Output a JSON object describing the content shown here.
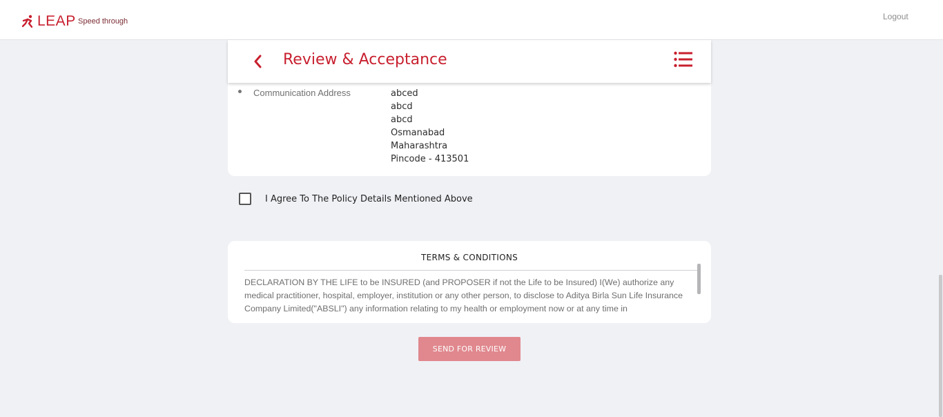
{
  "brand": {
    "name": "LEAP",
    "tagline": "Speed through",
    "accent_color": "#c8202f"
  },
  "topbar": {
    "logout_label": "Logout"
  },
  "header": {
    "title": "Review & Acceptance",
    "back_icon": "chevron-left-icon",
    "menu_icon": "list-menu-icon"
  },
  "details": {
    "communication_address": {
      "label": "Communication Address",
      "lines": [
        "abced",
        "abcd",
        "abcd",
        "Osmanabad",
        "Maharashtra",
        "Pincode - 413501"
      ]
    }
  },
  "agreement": {
    "label": "I Agree To The Policy Details Mentioned Above",
    "checked": false
  },
  "terms": {
    "title": "TERMS & CONDITIONS",
    "body": "DECLARATION BY THE LIFE to be INSURED (and PROPOSER if not the Life to be Insured) I(We) authorize any medical practitioner, hospital, employer, institution or any other person, to disclose to Aditya Birla Sun Life Insurance Company Limited(\"ABSLI\") any information relating to my health or employment now or at any time in"
  },
  "actions": {
    "send_label": "SEND FOR REVIEW",
    "send_color": "#e0888e"
  }
}
